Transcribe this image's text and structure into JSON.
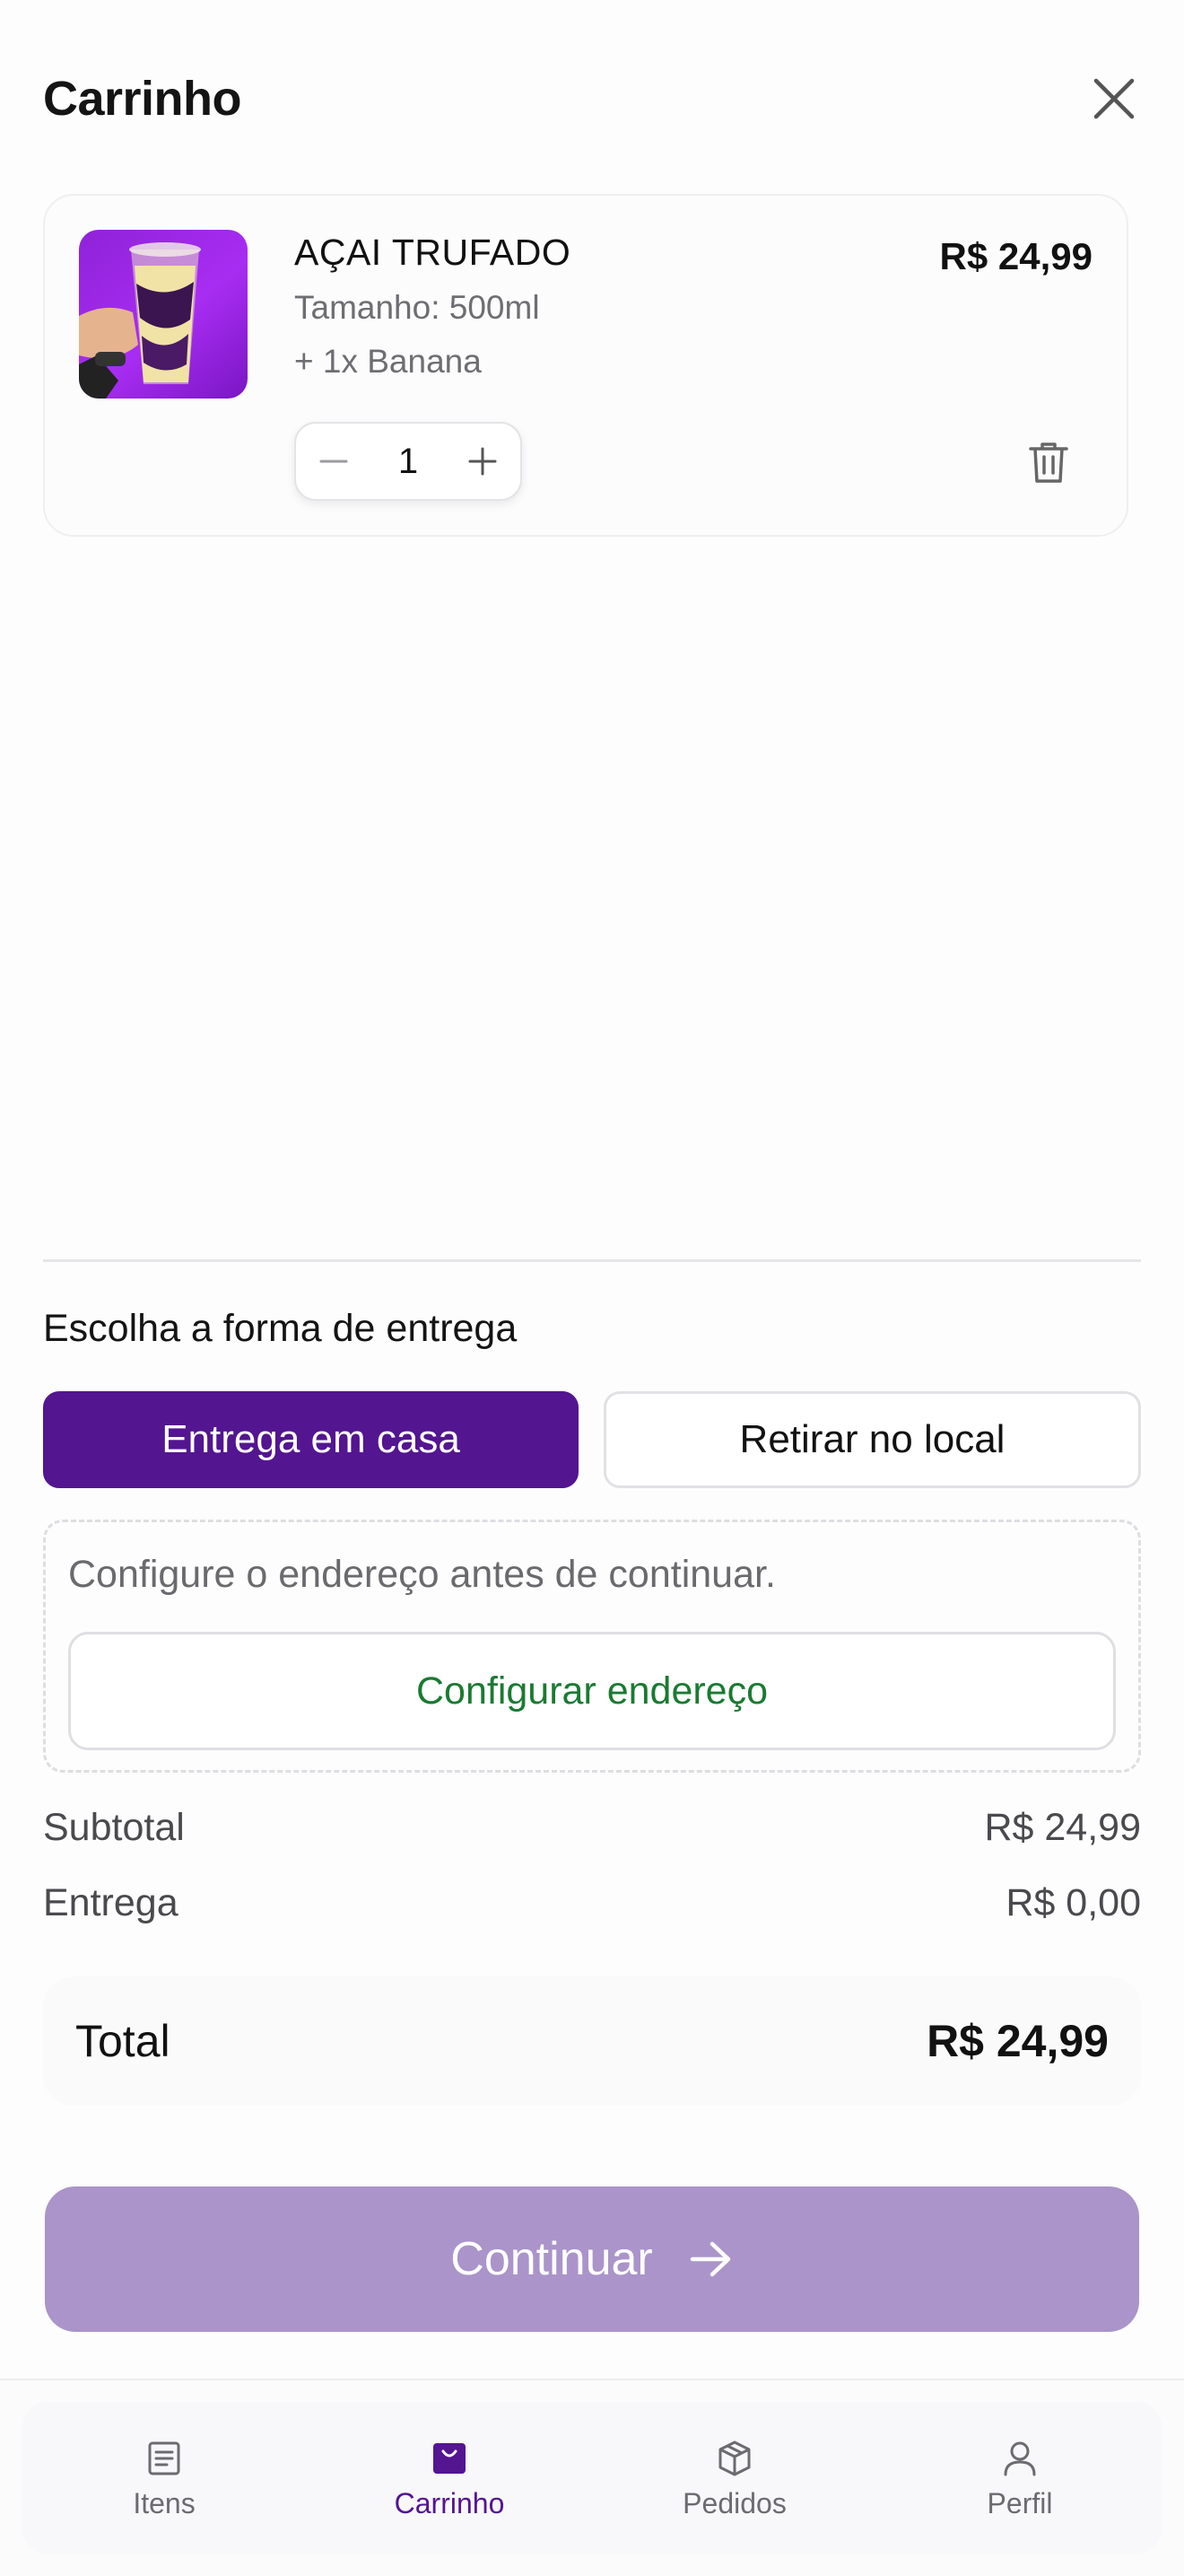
{
  "header": {
    "title": "Carrinho",
    "close_icon": "close-icon"
  },
  "cart": {
    "items": [
      {
        "name": "AÇAI TRUFADO",
        "size": "Tamanho: 500ml",
        "addon": "+ 1x Banana",
        "price": "R$ 24,99",
        "quantity": "1"
      }
    ]
  },
  "delivery": {
    "title": "Escolha a forma de entrega",
    "options": [
      "Entrega em casa",
      "Retirar no local"
    ],
    "selected": "Entrega em casa",
    "address_warning": "Configure o endereço antes de continuar.",
    "configure_button": "Configurar endereço"
  },
  "summary": {
    "subtotal_label": "Subtotal",
    "subtotal_value": "R$ 24,99",
    "delivery_label": "Entrega",
    "delivery_value": "R$ 0,00",
    "total_label": "Total",
    "total_value": "R$ 24,99"
  },
  "continue_label": "Continuar",
  "nav": {
    "items": [
      {
        "label": "Itens",
        "icon": "list-icon",
        "active": false
      },
      {
        "label": "Carrinho",
        "icon": "shopping-bag-icon",
        "active": true
      },
      {
        "label": "Pedidos",
        "icon": "package-icon",
        "active": false
      },
      {
        "label": "Perfil",
        "icon": "user-icon",
        "active": false
      }
    ]
  },
  "colors": {
    "primary": "#531590",
    "primary_disabled": "#aa94c9",
    "success_text": "#1a7a32"
  }
}
